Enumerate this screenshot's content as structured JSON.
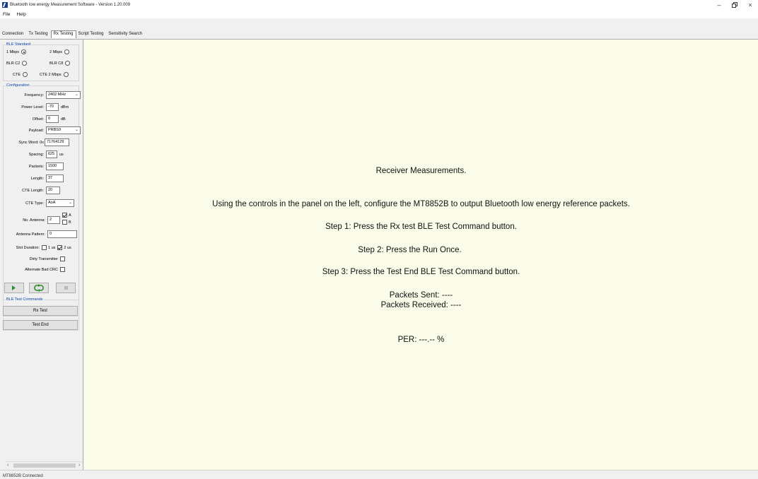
{
  "window": {
    "title": "Bluetooth low energy Measurement Software - Version 1.20.009",
    "controls": [
      "–",
      "ơ",
      "×"
    ]
  },
  "menu": [
    "File",
    "Help"
  ],
  "tabs": [
    "Connection",
    "Tx Testing",
    "Rx Testing",
    "Script Testing",
    "Sensitivity Search"
  ],
  "active_tab": "Rx Testing",
  "ble_standard": {
    "title": "BLE Standard",
    "options": [
      {
        "label": "1 Mbps",
        "selected": true
      },
      {
        "label": "2 Mbps",
        "selected": false
      },
      {
        "label": "BLR C2",
        "selected": false
      },
      {
        "label": "BLR C8",
        "selected": false
      },
      {
        "label": "CTE",
        "selected": false
      },
      {
        "label": "CTE 2 Mbps",
        "selected": false
      }
    ]
  },
  "configuration": {
    "title": "Configuration",
    "frequency_label": "Frequency:",
    "frequency_value": "2402 MHz",
    "power_label": "Power Level:",
    "power_value": "-70",
    "power_unit": "dBm",
    "offset_label": "Offset:",
    "offset_value": "0",
    "offset_unit": "dB",
    "payload_label": "Payload:",
    "payload_value": "PRBS9",
    "sync_label": "Sync Word: 0x",
    "sync_value": "71764129",
    "spacing_label": "Spacing:",
    "spacing_value": "625",
    "spacing_unit": "us",
    "packets_label": "Packets:",
    "packets_value": "1500",
    "length_label": "Length:",
    "length_value": "37",
    "cte_length_label": "CTE Length:",
    "cte_length_value": "20",
    "cte_type_label": "CTE Type:",
    "cte_type_value": "AoA",
    "antennas_label": "No. Antenna:",
    "antennas_value": "2",
    "antenna_a_label": "A",
    "antenna_a_checked": true,
    "antenna_b_label": "B",
    "antenna_b_checked": false,
    "pattern_label": "Antenna Pattern:",
    "pattern_value": "0",
    "slot_label": "Slot Duration:",
    "slot_1us_label": "1 us",
    "slot_1us_checked": false,
    "slot_2us_label": "2 us",
    "slot_2us_checked": true,
    "dirty_label": "Dirty Transmitter",
    "dirty_checked": false,
    "crc_label": "Alternate Bad CRC",
    "crc_checked": false
  },
  "commands": {
    "title": "BLE Test Commands",
    "rx_test": "Rx Test",
    "test_end": "Test End"
  },
  "main": {
    "heading": "Receiver Measurements.",
    "instruction": "Using the controls in the panel on the left, configure the MT8852B to output Bluetooth low energy reference packets.",
    "step1": "Step 1: Press the Rx test BLE Test Command button.",
    "step2": "Step 2: Press the Run Once.",
    "step3": "Step 3: Press the Test End BLE Test Command button.",
    "packets_sent": "Packets Sent: ----",
    "packets_received": "Packets Received: ----",
    "per": "PER: ---.-- %"
  },
  "status": "MT8852B Connected",
  "colors": {
    "main_bg": "#fbfbe9",
    "group_title": "#0a3fa8",
    "run_icon": "#2e8b2e"
  }
}
